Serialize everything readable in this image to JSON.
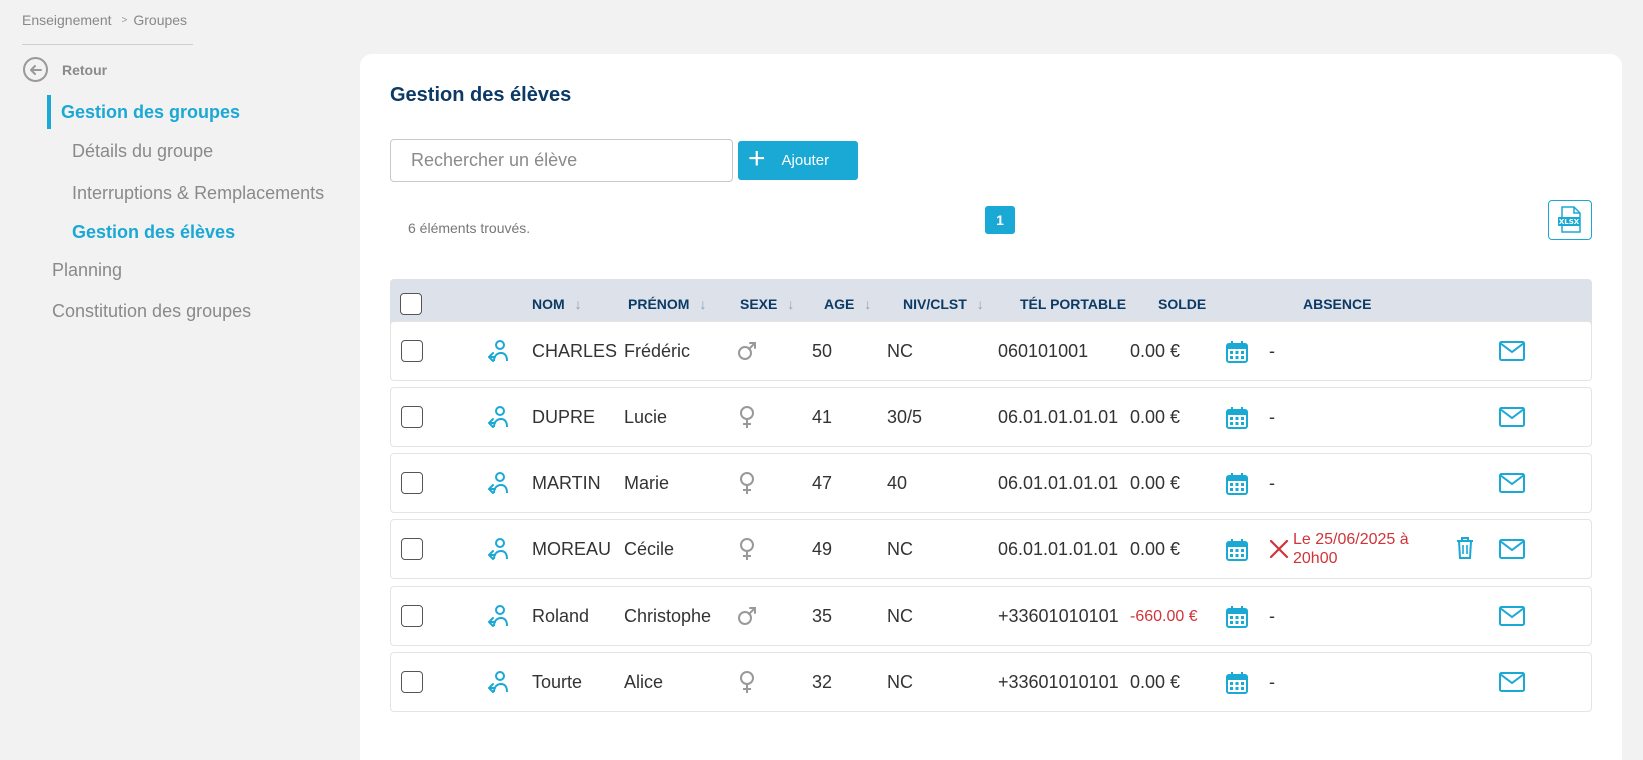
{
  "breadcrumb": {
    "root": "Enseignement",
    "sep": ">",
    "current": "Groupes"
  },
  "sidebar": {
    "back_label": "Retour",
    "active_section": "Gestion des groupes",
    "sub_items": [
      {
        "label": "Détails du groupe",
        "current": false
      },
      {
        "label": "Interruptions & Remplacements",
        "current": false
      },
      {
        "label": "Gestion des élèves",
        "current": true
      }
    ],
    "top_items": [
      {
        "label": "Planning"
      },
      {
        "label": "Constitution des groupes"
      }
    ]
  },
  "main": {
    "title": "Gestion des élèves",
    "search_placeholder": "Rechercher un élève",
    "add_label": "Ajouter",
    "count_text": "6 éléments trouvés.",
    "current_page": "1",
    "export_icon": "xlsx-file-icon"
  },
  "table": {
    "headers": {
      "nom": "NOM",
      "prenom": "PRÉNOM",
      "sexe": "SEXE",
      "age": "AGE",
      "niv": "NIV/CLST",
      "tel": "TÉL PORTABLE",
      "solde": "SOLDE",
      "absence": "ABSENCE"
    },
    "rows": [
      {
        "nom": "CHARLES",
        "prenom": "Frédéric",
        "sexe": "male",
        "age": "50",
        "niv": "NC",
        "tel": "060101001",
        "solde": "0.00 €",
        "solde_negative": false,
        "absence": "-",
        "absence_set": false
      },
      {
        "nom": "DUPRE",
        "prenom": "Lucie",
        "sexe": "female",
        "age": "41",
        "niv": "30/5",
        "tel": "06.01.01.01.01",
        "solde": "0.00 €",
        "solde_negative": false,
        "absence": "-",
        "absence_set": false
      },
      {
        "nom": "MARTIN",
        "prenom": "Marie",
        "sexe": "female",
        "age": "47",
        "niv": "40",
        "tel": "06.01.01.01.01",
        "solde": "0.00 €",
        "solde_negative": false,
        "absence": "-",
        "absence_set": false
      },
      {
        "nom": "MOREAU",
        "prenom": "Cécile",
        "sexe": "female",
        "age": "49",
        "niv": "NC",
        "tel": "06.01.01.01.01",
        "solde": "0.00 €",
        "solde_negative": false,
        "absence": "Le 25/06/2025 à 20h00",
        "absence_set": true
      },
      {
        "nom": "Roland",
        "prenom": "Christophe",
        "sexe": "male",
        "age": "35",
        "niv": "NC",
        "tel": "+33601010101",
        "solde": "-660.00 €",
        "solde_negative": true,
        "absence": "-",
        "absence_set": false
      },
      {
        "nom": "Tourte",
        "prenom": "Alice",
        "sexe": "female",
        "age": "32",
        "niv": "NC",
        "tel": "+33601010101",
        "solde": "0.00 €",
        "solde_negative": false,
        "absence": "-",
        "absence_set": false
      }
    ]
  },
  "colors": {
    "accent": "#1aa8d4",
    "title": "#0c3a66",
    "header_bg": "#dde2ea",
    "negative": "#d0343a",
    "muted": "#8a8a8a"
  }
}
